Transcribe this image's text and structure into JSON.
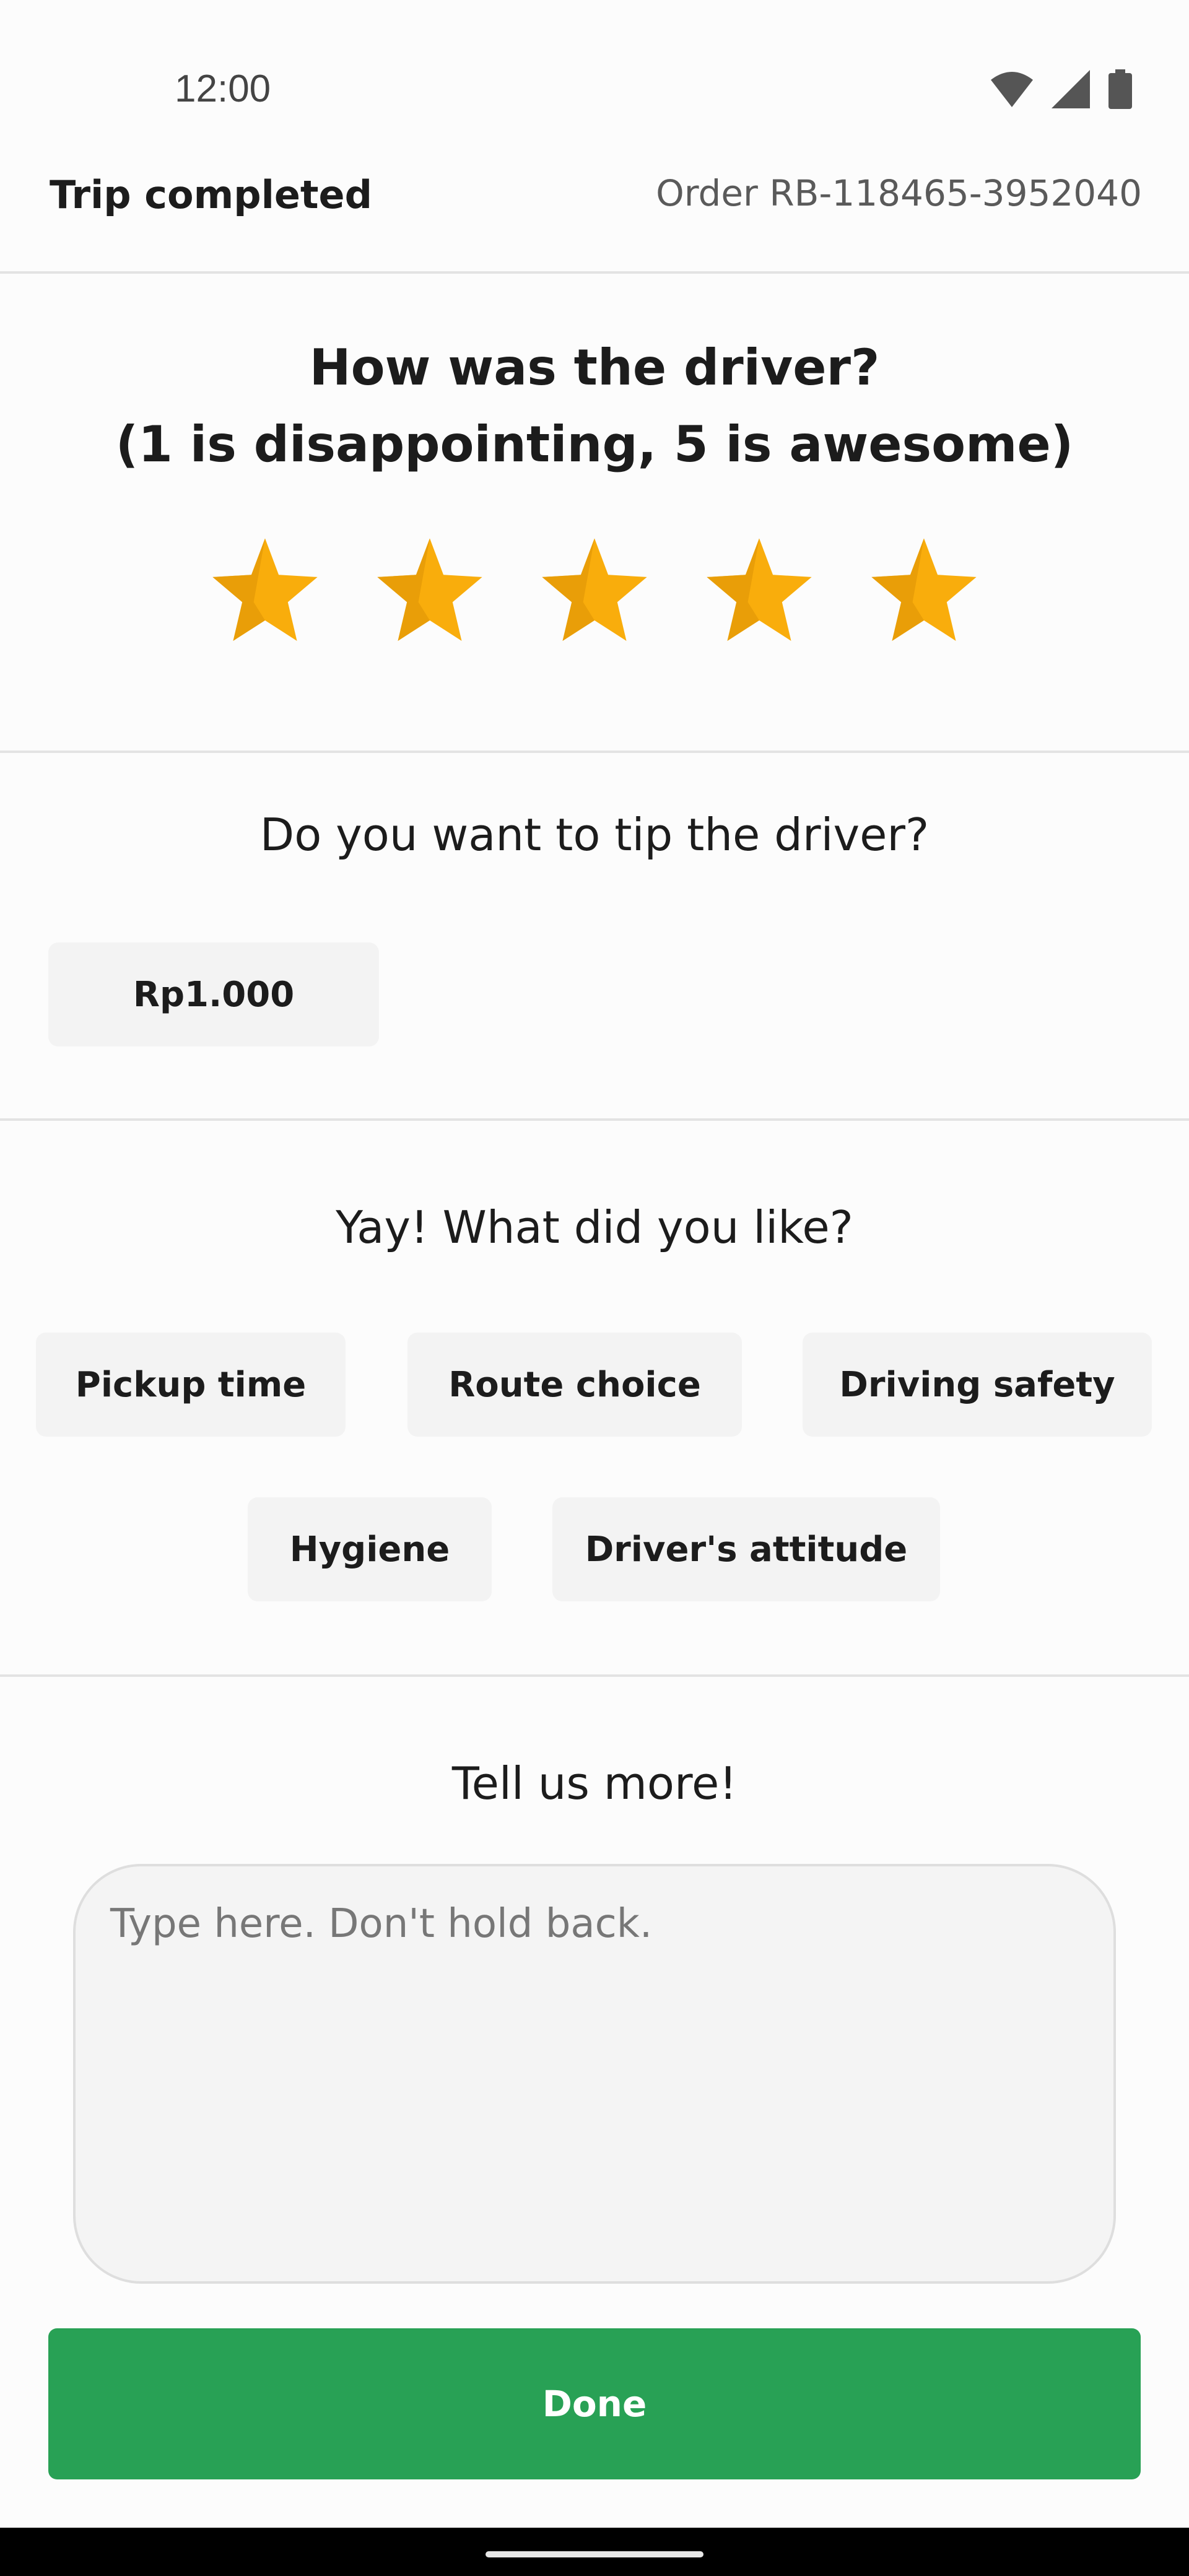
{
  "status_bar": {
    "time": "12:00",
    "icons": [
      "wifi-icon",
      "cellular-signal-icon",
      "battery-icon"
    ]
  },
  "header": {
    "title": "Trip completed",
    "order": "Order RB-118465-3952040"
  },
  "rating": {
    "question_line1": "How was the driver?",
    "question_line2": "(1 is disappointing, 5 is awesome)",
    "max_stars": 5,
    "selected_stars": 5,
    "star_color": "#f9ad0c"
  },
  "tip": {
    "question": "Do you want to tip the driver?",
    "options": [
      "Rp1.000"
    ]
  },
  "likes": {
    "question": "Yay! What did you like?",
    "options": [
      "Pickup time",
      "Route choice",
      "Driving safety",
      "Hygiene",
      "Driver's attitude"
    ]
  },
  "feedback": {
    "heading": "Tell us more!",
    "placeholder": "Type here. Don't hold back.",
    "value": ""
  },
  "done_button": {
    "label": "Done",
    "color": "#28a155"
  }
}
